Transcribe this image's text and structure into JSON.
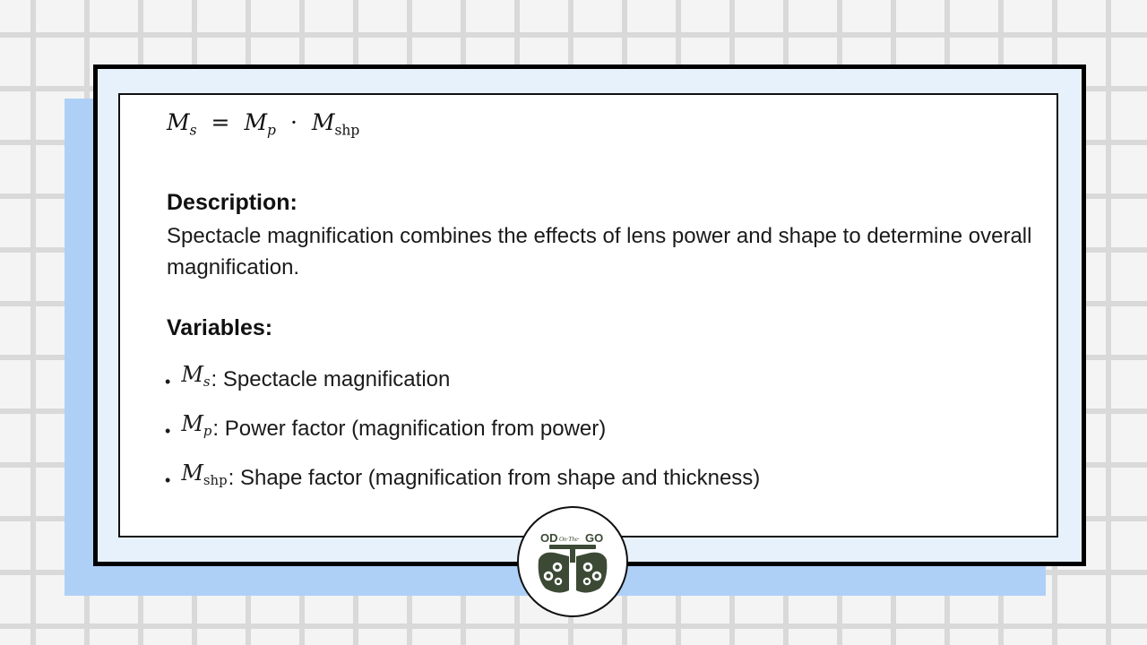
{
  "formula": {
    "lhs": "M",
    "lhs_sub": "s",
    "eq": "=",
    "t1": "M",
    "t1_sub": "p",
    "dot": "·",
    "t2": "M",
    "t2_sub": "shp"
  },
  "description": {
    "heading": "Description:",
    "text": "Spectacle magnification combines the effects of lens power and shape to determine overall magnification."
  },
  "variables": {
    "heading": "Variables:",
    "items": [
      {
        "bullet": "•",
        "symbol": "M",
        "sub": "s",
        "text": ": Spectacle magnification"
      },
      {
        "bullet": "•",
        "symbol": "M",
        "sub": "p",
        "text": ": Power factor (magnification from power)"
      },
      {
        "bullet": "•",
        "symbol": "M",
        "sub": "shp",
        "text": ": Shape factor (magnification from shape and thickness)"
      }
    ]
  },
  "logo": {
    "brand": "OD On-The-GO",
    "icon": "phoropter-icon"
  },
  "colors": {
    "background": "#f4f4f4",
    "grid": "#d9d9d9",
    "shadow": "#aed0f7",
    "frame": "#e7f1fb",
    "logo_green": "#3c4a35"
  }
}
